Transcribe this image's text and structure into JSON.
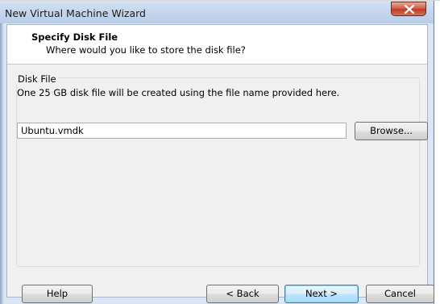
{
  "window": {
    "title": "New Virtual Machine Wizard",
    "close_icon": "close-x-icon"
  },
  "header": {
    "title": "Specify Disk File",
    "subtitle": "Where would you like to store the disk file?"
  },
  "disk_file_group": {
    "label": "Disk File",
    "description": "One 25 GB disk file will be created using the file name provided here.",
    "file_name_value": "Ubuntu.vmdk",
    "browse_label": "Browse..."
  },
  "footer": {
    "help_label": "Help",
    "back_label": "< Back",
    "next_label": "Next >",
    "cancel_label": "Cancel"
  },
  "colors": {
    "close_button": "#c8462f",
    "default_button_border": "#3c7fb1",
    "window_frame": "#dbe6f4"
  }
}
